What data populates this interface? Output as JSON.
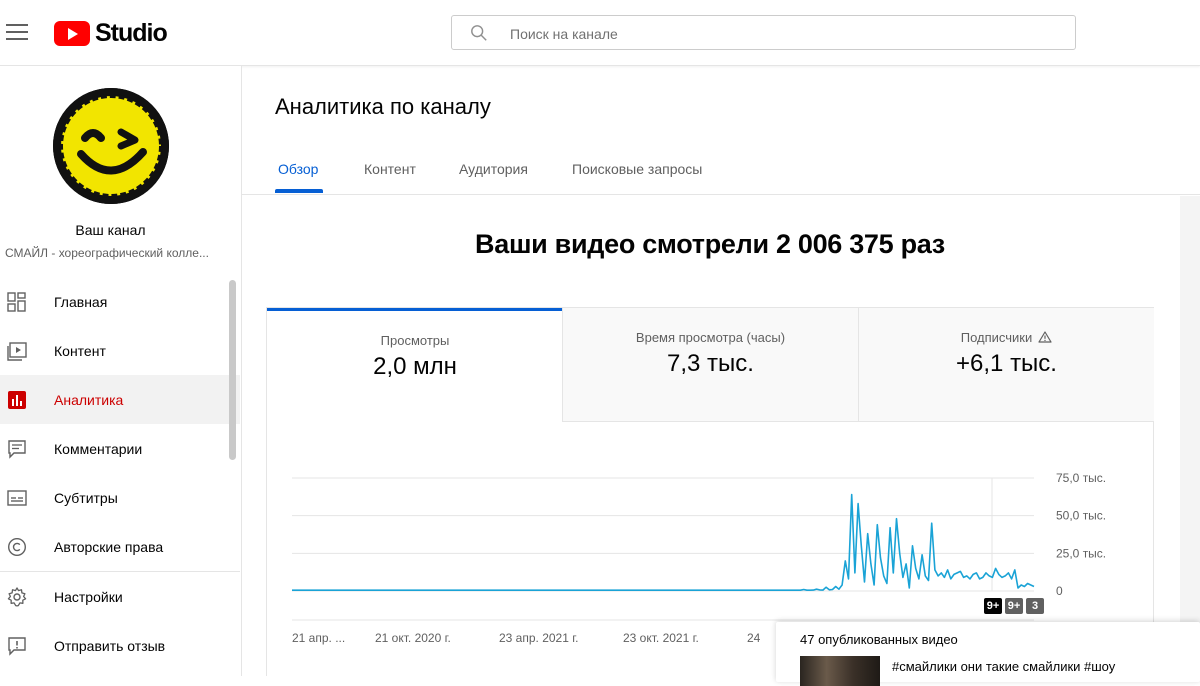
{
  "header": {
    "logo_text": "Studio",
    "search_placeholder": "Поиск на канале"
  },
  "sidebar": {
    "channel_label": "Ваш канал",
    "channel_name": "СМАЙЛ - хореографический колле...",
    "items": [
      {
        "label": "Главная",
        "icon": "dashboard-icon"
      },
      {
        "label": "Контент",
        "icon": "content-icon"
      },
      {
        "label": "Аналитика",
        "icon": "analytics-icon",
        "active": true
      },
      {
        "label": "Комментарии",
        "icon": "comments-icon"
      },
      {
        "label": "Субтитры",
        "icon": "subtitles-icon"
      },
      {
        "label": "Авторские права",
        "icon": "copyright-icon"
      },
      {
        "label": "Настройки",
        "icon": "settings-icon"
      },
      {
        "label": "Отправить отзыв",
        "icon": "feedback-icon"
      }
    ]
  },
  "main": {
    "title": "Аналитика по каналу",
    "tabs": [
      "Обзор",
      "Контент",
      "Аудитория",
      "Поисковые запросы"
    ],
    "active_tab": "Обзор",
    "headline": "Ваши видео смотрели 2 006 375 раз",
    "metrics": [
      {
        "label": "Просмотры",
        "value": "2,0 млн"
      },
      {
        "label": "Время просмотра (часы)",
        "value": "7,3 тыс."
      },
      {
        "label": "Подписчики",
        "value": "+6,1 тыс."
      }
    ],
    "badges": [
      "9+",
      "9+",
      "3"
    ]
  },
  "videos_panel": {
    "title": "47 опубликованных видео",
    "first_video_title": "#смайлики они такие смайлики #шоу"
  },
  "colors": {
    "accent": "#065fd4",
    "active_nav": "#cc0000",
    "brand_red": "#ff0000",
    "line": "#1aa3d6"
  },
  "chart_data": {
    "type": "line",
    "y_tick_labels": [
      "75,0 тыс.",
      "50,0 тыс.",
      "25,0 тыс.",
      "0"
    ],
    "yticks": [
      75000,
      50000,
      25000,
      0
    ],
    "ylim": [
      0,
      75000
    ],
    "x_tick_labels": [
      "21 апр. ...",
      "21 окт. 2020 г.",
      "23 апр. 2021 г.",
      "23 окт. 2021 г.",
      "24"
    ],
    "grid": true,
    "series": [
      {
        "values": [
          500,
          500,
          500,
          500,
          500,
          500,
          500,
          500,
          500,
          500,
          500,
          500,
          500,
          500,
          500,
          500,
          500,
          500,
          500,
          500,
          500,
          500,
          500,
          500,
          500,
          500,
          500,
          500,
          500,
          500,
          500,
          500,
          500,
          500,
          500,
          500,
          500,
          500,
          500,
          500,
          500,
          500,
          500,
          500,
          500,
          500,
          500,
          500,
          500,
          500,
          500,
          500,
          500,
          500,
          500,
          500,
          500,
          500,
          500,
          500,
          500,
          500,
          500,
          500,
          500,
          500,
          500,
          500,
          500,
          500,
          500,
          500,
          500,
          500,
          500,
          500,
          500,
          500,
          500,
          500,
          500,
          500,
          500,
          500,
          500,
          500,
          500,
          500,
          500,
          500,
          500,
          500,
          500,
          500,
          500,
          500,
          500,
          500,
          500,
          500,
          500,
          500,
          500,
          500,
          500,
          500,
          500,
          500,
          500,
          500,
          500,
          500,
          500,
          500,
          500,
          500,
          500,
          500,
          500,
          500,
          500,
          500,
          500,
          500,
          500,
          500,
          500,
          500,
          500,
          500,
          500,
          500,
          500,
          500,
          500,
          500,
          500,
          500,
          500,
          500,
          500,
          500,
          500,
          500,
          500,
          500,
          500,
          500,
          500,
          500,
          500,
          500,
          500,
          500,
          500,
          500,
          500,
          500,
          500,
          500,
          1000,
          500,
          500,
          600,
          1200,
          700,
          600,
          2500,
          800,
          1000,
          3000,
          1200,
          4000,
          20000,
          8000,
          64000,
          12000,
          58000,
          30000,
          6000,
          38000,
          18000,
          4000,
          44000,
          22000,
          10000,
          5000,
          42000,
          12000,
          48000,
          25000,
          9000,
          18000,
          2000,
          30000,
          15000,
          8000,
          24000,
          10000,
          7000,
          45000,
          14000,
          10000,
          12000,
          9000,
          14000,
          8000,
          11000,
          12000,
          13000,
          9000,
          10000,
          8000,
          11000,
          12000,
          8000,
          9000,
          12000,
          10000,
          9000,
          15000,
          11000,
          9000,
          10000,
          12000,
          8000,
          14000,
          2000,
          4000,
          3000,
          5000,
          4000,
          3000
        ]
      }
    ]
  }
}
